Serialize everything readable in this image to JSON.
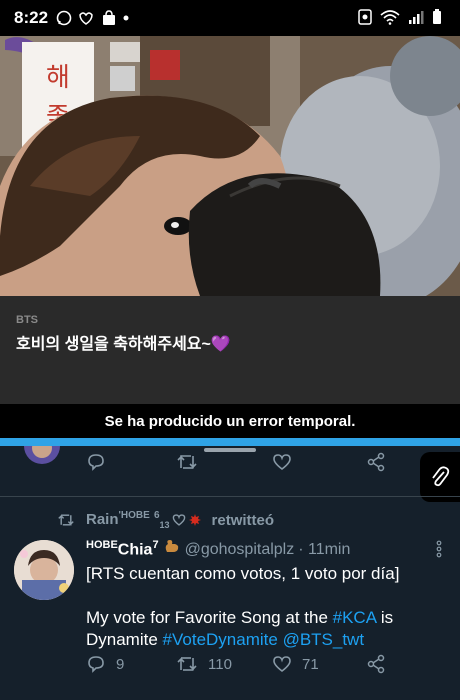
{
  "status_bar": {
    "time": "8:22"
  },
  "post": {
    "source": "BTS",
    "text": "호비의 생일을 축하해주세요~",
    "heart_emoji": "💜",
    "sign_text": [
      "해",
      "좋"
    ]
  },
  "error_message": "Se ha producido un error temporal.",
  "tweet_actions_top": {
    "reply": "",
    "retweet": "",
    "like": ""
  },
  "retweet_banner": {
    "user": "Rain",
    "user_suffix": "'HOBE",
    "numbers": "6",
    "subnumbers": "13",
    "label": "retwitteó"
  },
  "tweet": {
    "display_name_prefix": "HOBE",
    "display_name": "Chia",
    "superscript": "7",
    "handle": "@gohospitalplz",
    "time": "· 11min",
    "line1": "[RTS cuentan como votos, 1 voto por día]",
    "line2_a": "My vote for Favorite Song at the ",
    "hashtag_kca": "#KCA",
    "line2_b": " is",
    "line3_a": "Dynamite ",
    "hashtag_vote": "#VoteDynamite",
    "mention": "@BTS_twt",
    "replies": "9",
    "retweets": "110",
    "likes": "71"
  },
  "colors": {
    "accent": "#1da1f2",
    "feed_bg": "#15202b",
    "error_bar": "#2fa3e6"
  }
}
